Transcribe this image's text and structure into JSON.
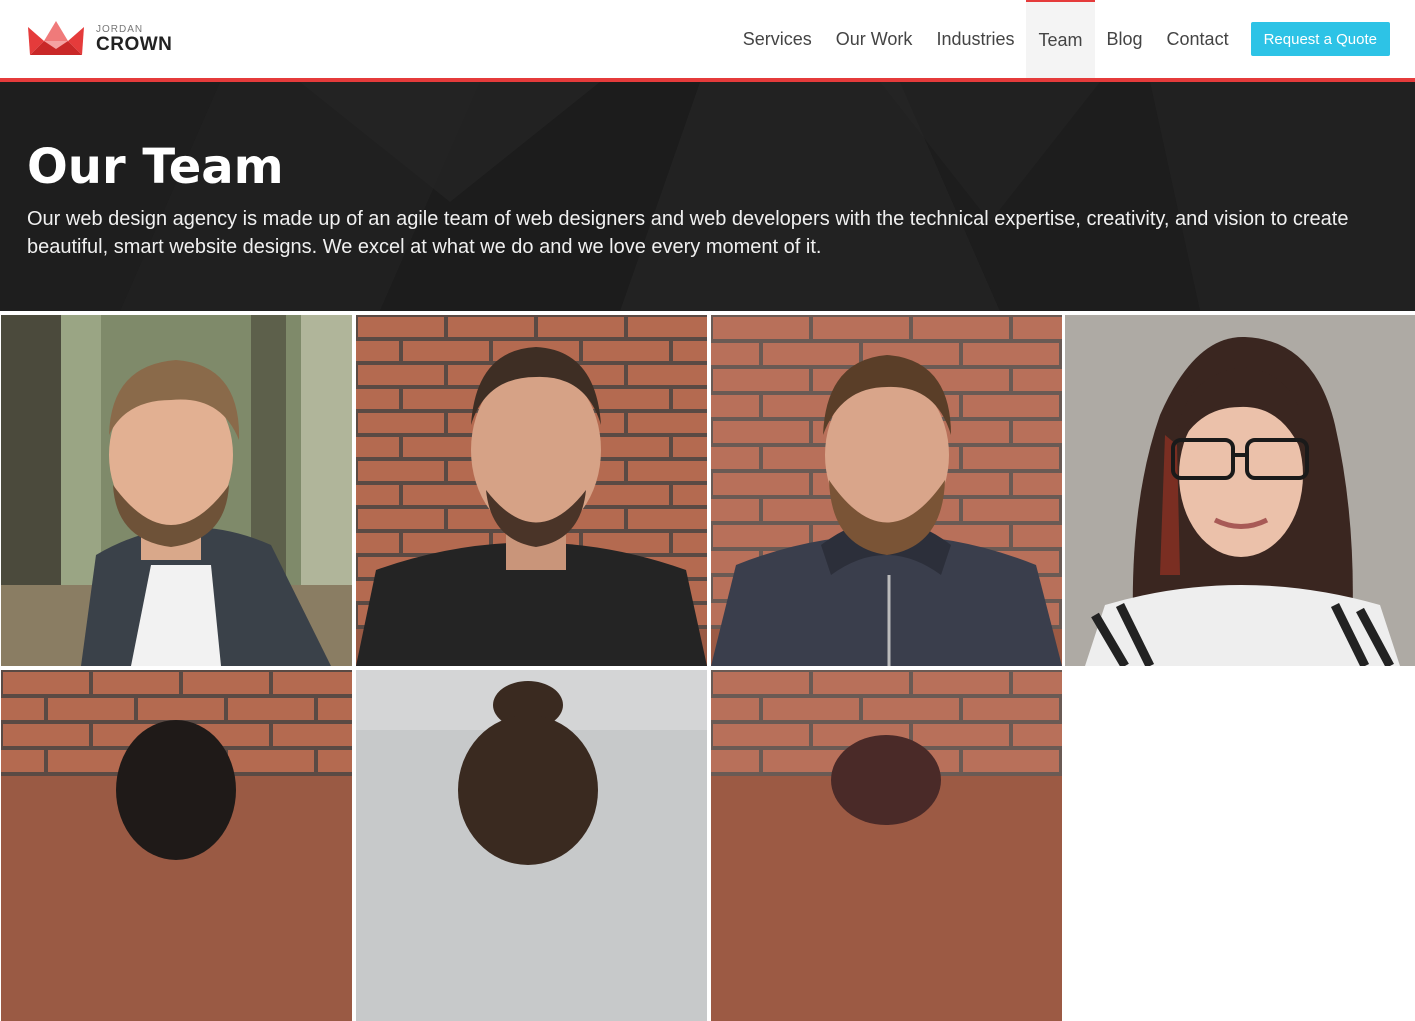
{
  "brand": {
    "small": "JORDAN",
    "big": "CROWN",
    "colors": {
      "accent": "#e53b3b",
      "cta": "#2dc3e6"
    }
  },
  "nav": {
    "items": [
      {
        "label": "Services"
      },
      {
        "label": "Our Work"
      },
      {
        "label": "Industries"
      },
      {
        "label": "Team",
        "active": true
      },
      {
        "label": "Blog"
      },
      {
        "label": "Contact"
      }
    ],
    "cta_label": "Request a Quote"
  },
  "hero": {
    "title": "Our Team",
    "text": "Our web design agency is made up of an agile team of web designers and web developers with the technical expertise, creativity, and vision to create beautiful, smart website designs. We excel at what we do and we love every moment of it."
  },
  "team": [
    {
      "photo": "man-blazer-forest"
    },
    {
      "photo": "man-black-shirt-brick"
    },
    {
      "photo": "man-jacket-brick"
    },
    {
      "photo": "woman-glasses-grey"
    },
    {
      "photo": "person-brick"
    },
    {
      "photo": "woman-bun-grey"
    },
    {
      "photo": "person-beanie-brick"
    }
  ]
}
